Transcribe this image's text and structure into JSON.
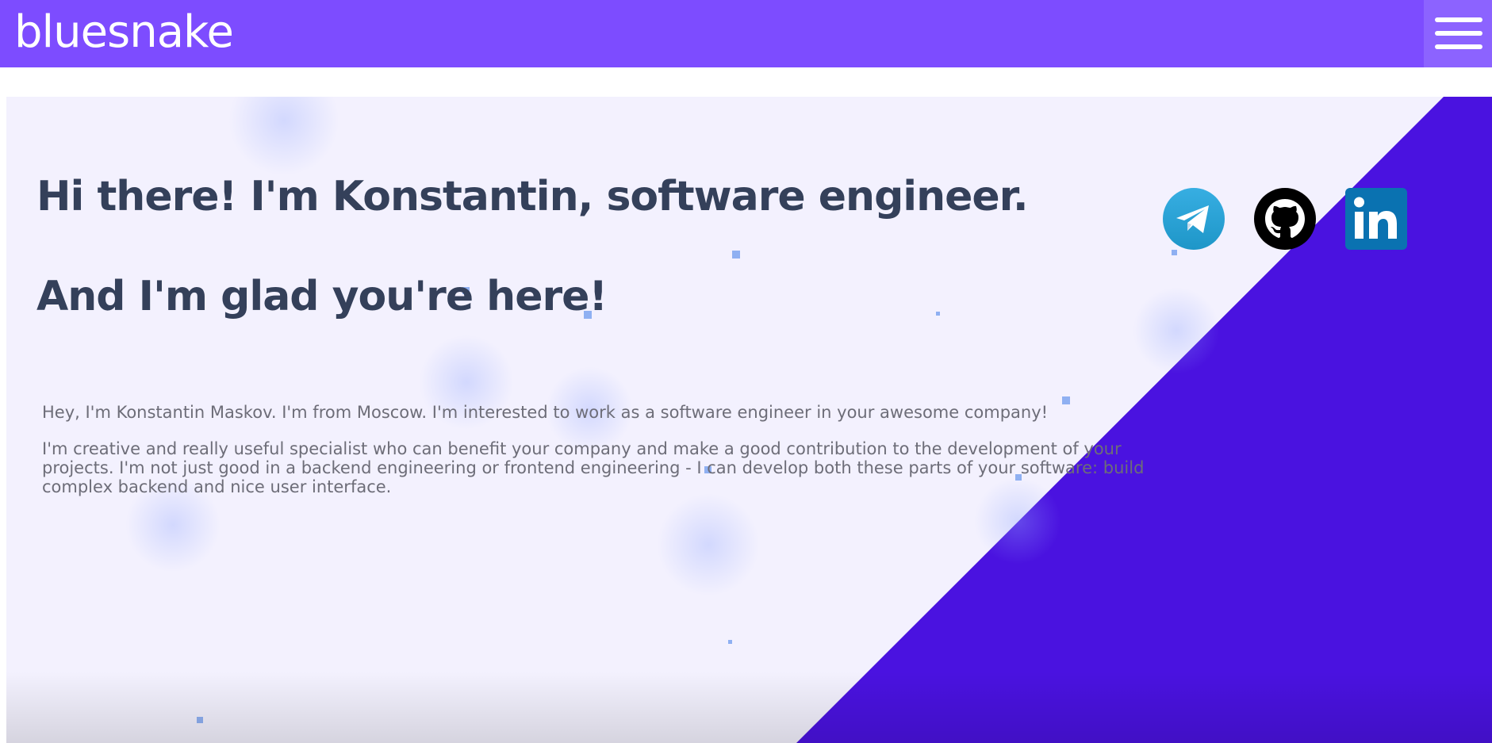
{
  "header": {
    "logo_text": "bluesnake",
    "menu_icon": "hamburger-icon",
    "bar_color": "#7d4cff"
  },
  "hero": {
    "headline_1": "Hi there! I'm Konstantin, software engineer.",
    "headline_2": "And I'm glad you're here!",
    "paragraph_1": "Hey, I'm Konstantin Maskov. I'm from Moscow. I'm interested to work as a software engineer in your awesome company!",
    "paragraph_2": "I'm creative and really useful specialist who can benefit your company and make a good contribution to the development of your projects. I'm not just good in a backend engineering or frontend engineering - I can develop both these parts of your software: build complex backend and nice user interface."
  },
  "social_links": [
    {
      "name": "telegram",
      "icon": "telegram-icon",
      "color": "#2aa3df"
    },
    {
      "name": "github",
      "icon": "github-icon",
      "color": "#000000"
    },
    {
      "name": "linkedin",
      "icon": "linkedin-icon",
      "color": "#0a72b1"
    }
  ],
  "colors": {
    "accent_purple": "#4a12e0",
    "background": "#f3f1fe",
    "heading_text": "#34405a",
    "body_text": "#6d6d78"
  }
}
